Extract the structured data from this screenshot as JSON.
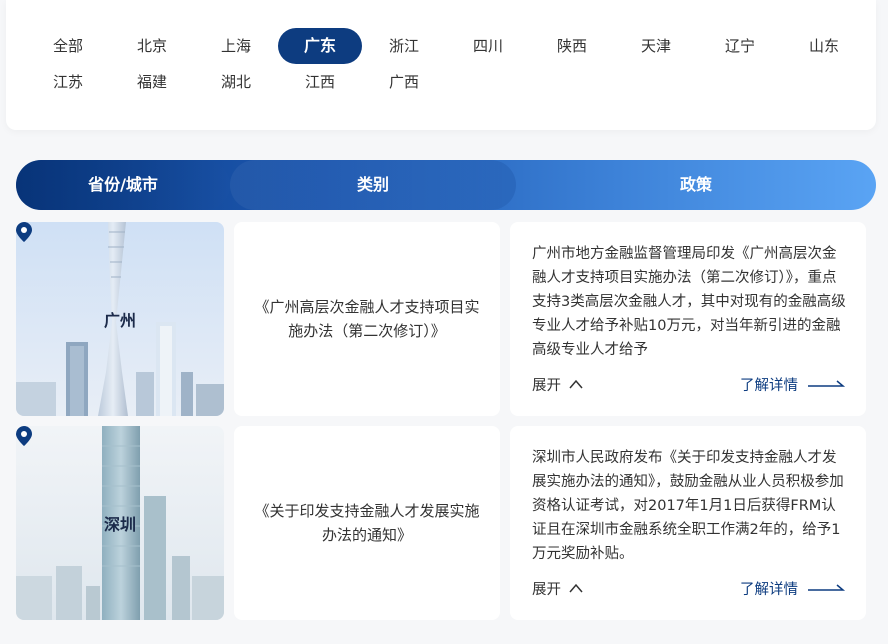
{
  "regions": [
    "全部",
    "北京",
    "上海",
    "广东",
    "浙江",
    "四川",
    "陕西",
    "天津",
    "辽宁",
    "山东",
    "江苏",
    "福建",
    "湖北",
    "江西",
    "广西"
  ],
  "active_region": "广东",
  "header": {
    "col1": "省份/城市",
    "col2": "类别",
    "col3": "政策"
  },
  "rows": [
    {
      "city": "广州",
      "title": "《广州高层次金融人才支持项目实施办法（第二次修订）》",
      "policy": "广州市地方金融监督管理局印发《广州高层次金融人才支持项目实施办法（第二次修订）》，重点支持3类高层次金融人才，其中对现有的金融高级专业人才给予补贴10万元，对当年新引进的金融高级专业人才给予",
      "expand": "展开",
      "detail": "了解详情"
    },
    {
      "city": "深圳",
      "title": "《关于印发支持金融人才发展实施办法的通知》",
      "policy": "深圳市人民政府发布《关于印发支持金融人才发展实施办法的通知》，鼓励金融从业人员积极参加资格认证考试，对2017年1月1日后获得FRM认证且在深圳市金融系统全职工作满2年的，给予1万元奖励补贴。",
      "expand": "展开",
      "detail": "了解详情"
    }
  ],
  "colors": {
    "primary": "#0d3c80",
    "gradient_end": "#5aa4f4"
  }
}
